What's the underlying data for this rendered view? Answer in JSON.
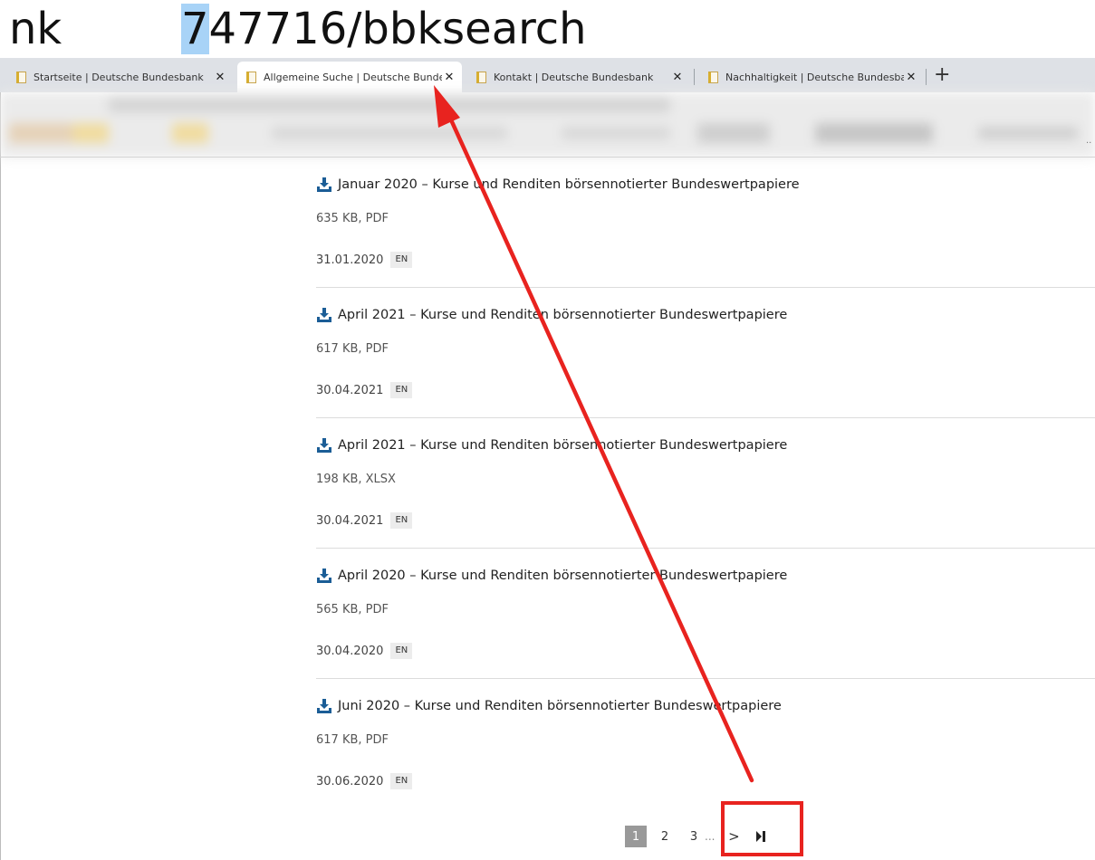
{
  "address_bar": {
    "left_text": "nk",
    "highlighted_char": "7",
    "right_text": "47716/bbksearch"
  },
  "tabs": [
    {
      "label": "Startseite | Deutsche Bundesbank"
    },
    {
      "label": "Allgemeine Suche | Deutsche Bundesbank"
    },
    {
      "label": "Kontakt | Deutsche Bundesbank"
    },
    {
      "label": "Nachhaltigkeit | Deutsche Bundesbank"
    }
  ],
  "tab_close_glyph": "✕",
  "new_tab_glyph": "+",
  "toolbar_overflow": "..",
  "results": [
    {
      "title": "Januar 2020 – Kurse und Renditen börsennotierter Bundeswertpapiere",
      "meta": "635 KB, PDF",
      "date": "31.01.2020",
      "lang": "EN"
    },
    {
      "title": "April 2021 – Kurse und Renditen börsennotierter Bundeswertpapiere",
      "meta": "617 KB, PDF",
      "date": "30.04.2021",
      "lang": "EN"
    },
    {
      "title": "April 2021 – Kurse und Renditen börsennotierter Bundeswertpapiere",
      "meta": "198 KB, XLSX",
      "date": "30.04.2021",
      "lang": "EN"
    },
    {
      "title": "April 2020 – Kurse und Renditen börsennotierter Bundeswertpapiere",
      "meta": "565 KB, PDF",
      "date": "30.04.2020",
      "lang": "EN"
    },
    {
      "title": "Juni 2020 – Kurse und Renditen börsennotierter Bundeswertpapiere",
      "meta": "617 KB, PDF",
      "date": "30.06.2020",
      "lang": "EN"
    }
  ],
  "pagination": {
    "pages": [
      "1",
      "2",
      "3"
    ],
    "current": "1",
    "ellipsis": "...",
    "next_glyph": ">"
  },
  "colors": {
    "annotation_red": "#e8231f",
    "download_icon_blue": "#1b5d96",
    "address_highlight": "#a8d3f7"
  }
}
